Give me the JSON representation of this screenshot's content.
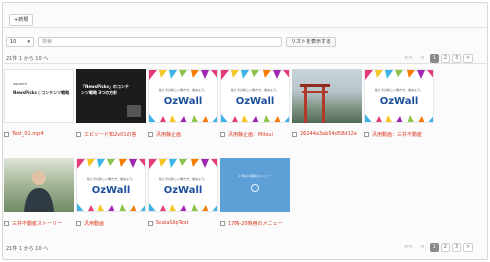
{
  "toolbar": {
    "new_label": "+新規"
  },
  "filter": {
    "per_page": "10",
    "search_placeholder": "検索",
    "list_button": "リストを表示する"
  },
  "info_top": "21件 1 から 10 へ",
  "info_bottom": "21件 1 から 10 へ",
  "pager": {
    "first": "<<",
    "prev": "<",
    "pages": [
      "1",
      "2",
      "3"
    ],
    "next": ">",
    "last": ">>",
    "active": "1"
  },
  "thumb_texts": {
    "nph_title": "NewsPicks | コンテンツ戦略",
    "nph_logo": "GROWTH",
    "dark_title": "「NewsPicks」のコンテンツ戦略 3つの方針",
    "ozwall_sub": "私たちの新しい働き方、始めよう。",
    "ozwall_logo": "OzWall",
    "blue_title": "17時-20時用のメニュー"
  },
  "items": [
    {
      "caption": "Test_01.mp4",
      "kind": "white"
    },
    {
      "caption": "エピソード知2v01の答",
      "kind": "dark"
    },
    {
      "caption": "汎用静止画",
      "kind": "ozwall"
    },
    {
      "caption": "汎用静止画：Mitsui",
      "kind": "ozwall"
    },
    {
      "caption": "26244a3ab54d58d12e",
      "kind": "photo1"
    },
    {
      "caption": "汎用動画：三井不動産",
      "kind": "ozwall"
    },
    {
      "caption": "三井不動産ストーリー",
      "kind": "photo2"
    },
    {
      "caption": "汎用動画",
      "kind": "ozwall"
    },
    {
      "caption": "ScalaSlipTest",
      "kind": "ozwall"
    },
    {
      "caption": "17時-20時用のメニュー",
      "kind": "blue"
    }
  ],
  "colors": {
    "caption": "#d9381e",
    "ozwall_logo": "#1d4f9a",
    "active_page": "#8a8a8a",
    "blue_thumb": "#5f9fd8"
  }
}
